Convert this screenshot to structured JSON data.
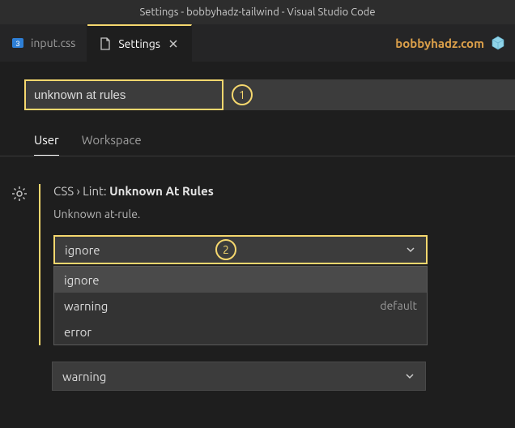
{
  "titlebar": "Settings - bobbyhadz-tailwind - Visual Studio Code",
  "tabs": {
    "file": "input.css",
    "settings": "Settings"
  },
  "brand": "bobbyhadz.com",
  "search": {
    "value": "unknown at rules",
    "callout": "1"
  },
  "scopes": {
    "user": "User",
    "workspace": "Workspace"
  },
  "setting": {
    "crumb": "CSS › Lint:",
    "name": "Unknown At Rules",
    "desc": "Unknown at-rule.",
    "selected": "ignore",
    "callout": "2",
    "options": [
      "ignore",
      "warning",
      "error"
    ],
    "default_option": "warning",
    "default_label": "default"
  },
  "second_select": {
    "value": "warning"
  }
}
